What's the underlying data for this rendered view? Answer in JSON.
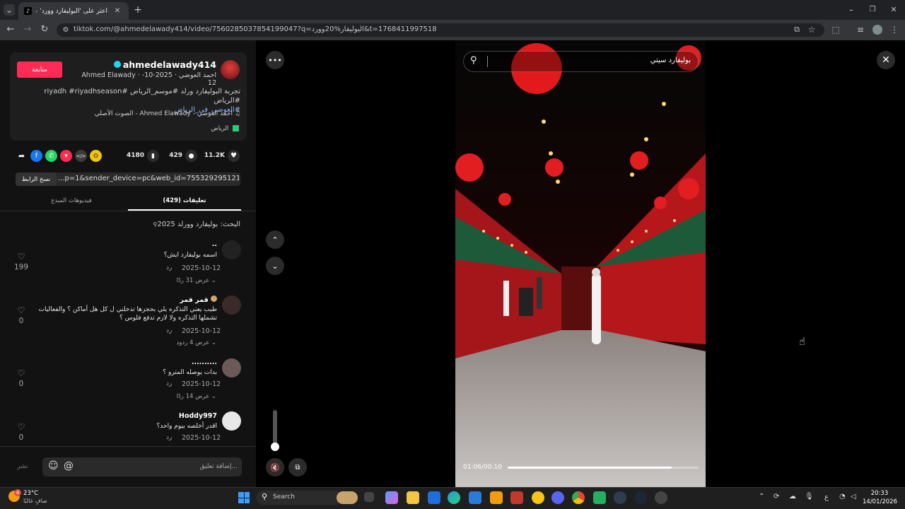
{
  "browser": {
    "tab_title": "اعثر على 'البوليفارد وورد' على TikTok",
    "url": "tiktok.com/@ahmedelawady414/video/7560285037854199047?q=البوليفار%20وورد&t=1768411997518"
  },
  "post": {
    "follow_label": "متابعة",
    "username": "ahmedelawady414",
    "author_meta": "Ahmed Elawady · احمد العوضي · 2025-10-12",
    "description_line1": "تجربة البوليفارد ورلد #موسم_الرياض #riyadh #riyadhseason #الرياض",
    "description_line2": "#العوضي_في_الرياض",
    "music": "الصوت الأصلي - Ahmed Elawady - احمد العوضي",
    "location": "الرياض",
    "likes": "11.2K",
    "comments": "429",
    "saves": "4180",
    "link": "...p=1&sender_device=pc&web_id=7553292951214360085",
    "copy_link_label": "نسخ الرابط"
  },
  "tabs": {
    "comments": "(429) تعليقات",
    "creator_videos": "فيديوهات المبدع"
  },
  "search_hint": "البحث: بوليفارد وورلد 2025",
  "comments_list": [
    {
      "user": "..",
      "text": "اسمه بوليفارد ايش؟",
      "date": "2025-10-12",
      "reply": "رد",
      "more": "عرض 31 ردًا",
      "likes": "199"
    },
    {
      "user": "قمر قمر",
      "text": "طيب يعني التذكره يلي بحجزها تدخلني ل كل هل أماكن ؟ والفعاليات تشملها التذكره ولا لازم تدفع فلوس ؟",
      "date": "2025-10-12",
      "reply": "رد",
      "more": "عرض 4 ردود",
      "likes": "0"
    },
    {
      "user": "..........",
      "text": "بدات يوصله المترو ؟",
      "date": "2025-10-12",
      "reply": "رد",
      "more": "عرض 14 ردًا",
      "likes": "0"
    },
    {
      "user": "Hoddy997",
      "text": "اقدر أخلصه بيوم واحد؟",
      "date": "2025-10-12",
      "reply": "رد",
      "more": "",
      "likes": "0"
    }
  ],
  "comment_input": {
    "placeholder": "إضافة تعليق...",
    "post_label": "نشر"
  },
  "player": {
    "search_text": "بوليفارد سيتي",
    "time": "01:06/00:10",
    "progress": 0.86
  },
  "taskbar": {
    "weather_temp": "23°C",
    "weather_text": "صافٍ غالبًا",
    "weather_badge": "4",
    "search_label": "Search",
    "lang": "ع",
    "time": "20:33",
    "date": "14/01/2026"
  }
}
